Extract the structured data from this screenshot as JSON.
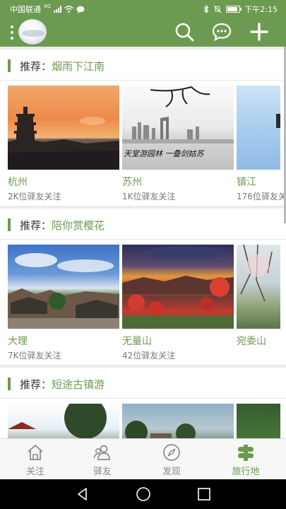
{
  "status_bar": {
    "carrier": "中国联通",
    "network_badge": "4G",
    "time": "下午2:15",
    "icons": [
      "signal-icon",
      "wifi-icon",
      "chat-bubble-icon",
      "bluetooth-icon",
      "mute-icon",
      "battery-icon"
    ],
    "battery_level": 0.9
  },
  "header": {
    "icons": [
      "menu-dots-icon",
      "avatar",
      "search-icon",
      "message-icon",
      "add-icon"
    ]
  },
  "sections": [
    {
      "label": "推荐：",
      "name": "烟雨下江南",
      "cards": [
        {
          "city": "杭州",
          "followers": "2K位驿友关注"
        },
        {
          "city": "苏州",
          "followers": "1K位驿友关注",
          "image_text": "天堂游园林 一叠剑姑苏"
        },
        {
          "city": "镇江",
          "followers": "176位驿友关注"
        }
      ]
    },
    {
      "label": "推荐：",
      "name": "陪你赏樱花",
      "cards": [
        {
          "city": "大理",
          "followers": "7K位驿友关注"
        },
        {
          "city": "无量山",
          "followers": "42位驿友关注"
        },
        {
          "city": "宛委山",
          "followers": ""
        }
      ]
    },
    {
      "label": "推荐：",
      "name": "短途古镇游",
      "cards": [
        {
          "city": "",
          "followers": ""
        },
        {
          "city": "",
          "followers": ""
        },
        {
          "city": "",
          "followers": ""
        }
      ]
    }
  ],
  "tabs": [
    {
      "label": "关注",
      "icon": "home-icon"
    },
    {
      "label": "驿友",
      "icon": "friends-icon"
    },
    {
      "label": "发现",
      "icon": "compass-icon"
    },
    {
      "label": "旅行地",
      "icon": "travel-map-icon",
      "active": true
    }
  ],
  "colors": {
    "brand_green": "#6c9a50",
    "tab_inactive": "#8a8a8a",
    "page_bg": "#ececec"
  },
  "system_nav": {
    "icons": [
      "back-icon",
      "home-circle-icon",
      "recents-icon"
    ]
  }
}
